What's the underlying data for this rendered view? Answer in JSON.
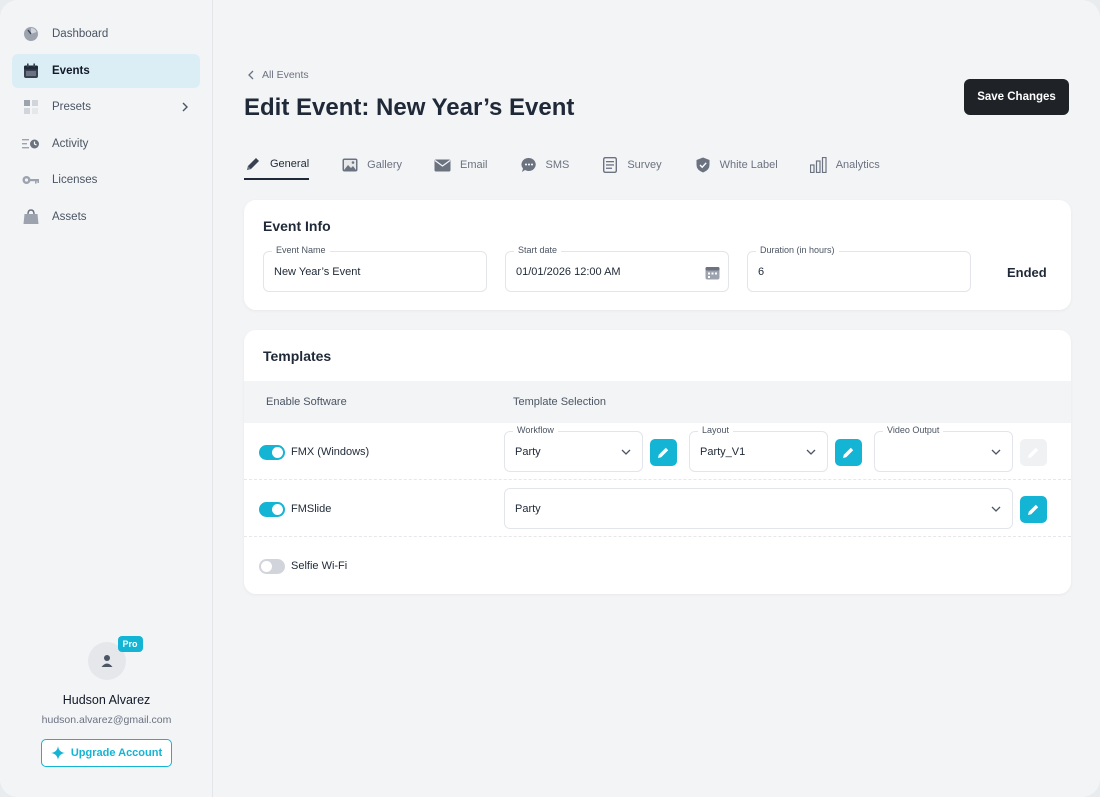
{
  "sidebar": {
    "items": [
      {
        "label": "Dashboard",
        "icon": "dashboard-icon"
      },
      {
        "label": "Events",
        "icon": "calendar-icon"
      },
      {
        "label": "Presets",
        "icon": "presets-icon"
      },
      {
        "label": "Activity",
        "icon": "activity-icon"
      },
      {
        "label": "Licenses",
        "icon": "key-icon"
      },
      {
        "label": "Assets",
        "icon": "bag-icon"
      }
    ],
    "user": {
      "badge": "Pro",
      "name": "Hudson Alvarez",
      "email": "hudson.alvarez@gmail.com",
      "upgrade_label": "Upgrade Account"
    }
  },
  "header": {
    "breadcrumb": "All Events",
    "title": "Edit Event: New Year’s Event",
    "save_label": "Save Changes"
  },
  "tabs": [
    {
      "label": "General",
      "icon": "pencil-icon"
    },
    {
      "label": "Gallery",
      "icon": "gallery-icon"
    },
    {
      "label": "Email",
      "icon": "mail-icon"
    },
    {
      "label": "SMS",
      "icon": "chat-icon"
    },
    {
      "label": "Survey",
      "icon": "survey-icon"
    },
    {
      "label": "White Label",
      "icon": "shield-icon"
    },
    {
      "label": "Analytics",
      "icon": "chart-icon"
    }
  ],
  "event_info": {
    "title": "Event Info",
    "event_name_label": "Event Name",
    "event_name_value": "New Year’s Event",
    "start_date_label": "Start date",
    "start_date_value": "01/01/2026 12:00 AM",
    "duration_label": "Duration (in hours)",
    "duration_value": "6",
    "status": "Ended"
  },
  "templates": {
    "title": "Templates",
    "col_enable": "Enable Software",
    "col_selection": "Template Selection",
    "rows": [
      {
        "label": "FMX (Windows)",
        "enabled": true,
        "workflow_label": "Workflow",
        "workflow_value": "Party",
        "layout_label": "Layout",
        "layout_value": "Party_V1",
        "video_label": "Video Output",
        "video_value": ""
      },
      {
        "label": "FMSlide",
        "enabled": true,
        "value": "Party"
      },
      {
        "label": "Selfie Wi-Fi",
        "enabled": false
      }
    ]
  },
  "colors": {
    "accent": "#13b4d4",
    "dark": "#1f2328",
    "active_nav_bg": "#dbeef6"
  }
}
